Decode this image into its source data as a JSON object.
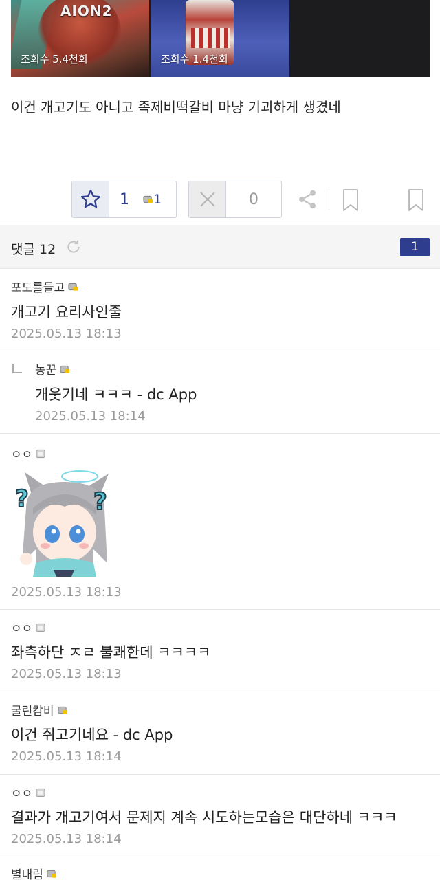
{
  "thumbnails": [
    {
      "logo": "AION2",
      "views": "조회수 5.4천회"
    },
    {
      "views": "조회수 1.4천회"
    }
  ],
  "post": {
    "body": "이건 개고기도 아니고 족제비떡갈비 마냥 기괴하게 생겼네"
  },
  "actions": {
    "recommend_count": "1",
    "fixed_recommend_count": "1",
    "nonrecommend_count": "0"
  },
  "comments_header": {
    "label": "댓글 12",
    "page": "1"
  },
  "comments": [
    {
      "nick": "포도를들고",
      "text": "개고기 요리사인줄",
      "date": "2025.05.13 18:13",
      "member": "fixed"
    },
    {
      "nick": "농꾼",
      "text": "개웃기네 ㅋㅋㅋ - dc App",
      "date": "2025.05.13 18:14",
      "member": "fixed",
      "reply": true
    },
    {
      "nick": "ㅇㅇ",
      "text": "",
      "date": "2025.05.13 18:13",
      "member": "flow",
      "sticker": "question-cat-girl"
    },
    {
      "nick": "ㅇㅇ",
      "text": "좌측하단 ㅈㄹ 불쾌한데 ㅋㅋㅋㅋ",
      "date": "2025.05.13 18:13",
      "member": "flow"
    },
    {
      "nick": "굴린캄비",
      "text": "이건 쥐고기네요 - dc App",
      "date": "2025.05.13 18:14",
      "member": "fixed"
    },
    {
      "nick": "ㅇㅇ",
      "text": "결과가 개고기여서 문제지 계속 시도하는모습은 대단하네 ㅋㅋㅋ",
      "date": "2025.05.13 18:14",
      "member": "flow"
    },
    {
      "nick": "별내림",
      "member": "fixed"
    }
  ],
  "colors": {
    "accent": "#2f3d8f",
    "date": "#9a9a9a",
    "header_bg": "#f5f5f6"
  }
}
